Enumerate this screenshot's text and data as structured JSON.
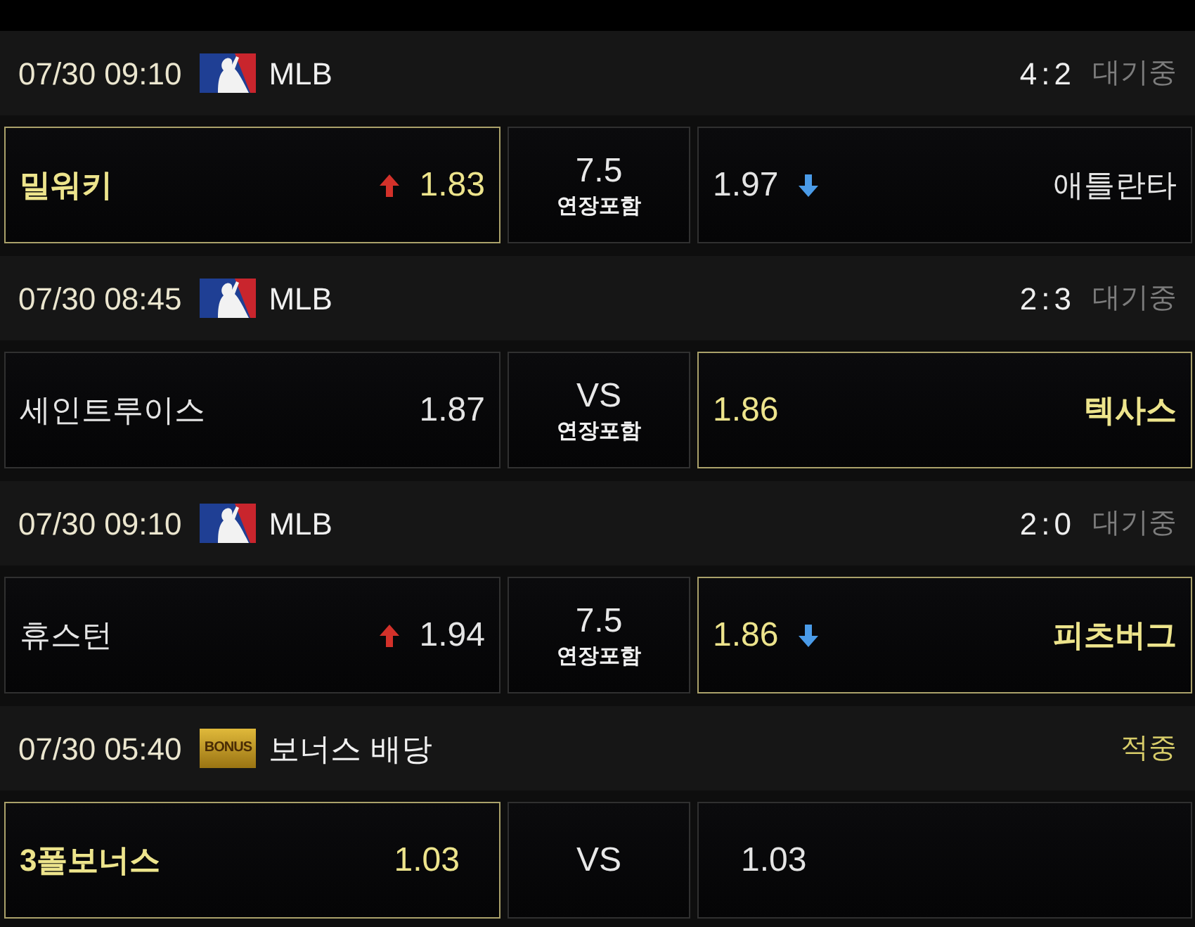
{
  "games": [
    {
      "date_time": "07/30 09:10",
      "league": {
        "kind": "mlb",
        "name": "MLB"
      },
      "score": "4:2",
      "status": {
        "kind": "waiting",
        "text": "대기중"
      },
      "home": {
        "team": "밀워키",
        "odds": "1.83",
        "rising": true,
        "selected": true
      },
      "line": {
        "value": "7.5",
        "note": "연장포함"
      },
      "away": {
        "team": "애틀란타",
        "odds": "1.97",
        "rising": false,
        "selected": false
      }
    },
    {
      "date_time": "07/30 08:45",
      "league": {
        "kind": "mlb",
        "name": "MLB"
      },
      "score": "2:3",
      "status": {
        "kind": "waiting",
        "text": "대기중"
      },
      "home": {
        "team": "세인트루이스",
        "odds": "1.87",
        "selected": false
      },
      "line": {
        "value": "VS",
        "note": "연장포함"
      },
      "away": {
        "team": "텍사스",
        "odds": "1.86",
        "selected": true
      }
    },
    {
      "date_time": "07/30 09:10",
      "league": {
        "kind": "mlb",
        "name": "MLB"
      },
      "score": "2:0",
      "status": {
        "kind": "waiting",
        "text": "대기중"
      },
      "home": {
        "team": "휴스턴",
        "odds": "1.94",
        "rising": true,
        "selected": false
      },
      "line": {
        "value": "7.5",
        "note": "연장포함"
      },
      "away": {
        "team": "피츠버그",
        "odds": "1.86",
        "rising": false,
        "selected": true
      }
    },
    {
      "date_time": "07/30 05:40",
      "league": {
        "kind": "bonus",
        "badge": "BONUS",
        "name": "보너스 배당"
      },
      "status": {
        "kind": "won",
        "text": "적중"
      },
      "home": {
        "team": "3폴보너스",
        "odds": "1.03",
        "selected": true
      },
      "line": {
        "value": "VS"
      },
      "away": {
        "odds": "1.03",
        "selected": false
      }
    }
  ]
}
